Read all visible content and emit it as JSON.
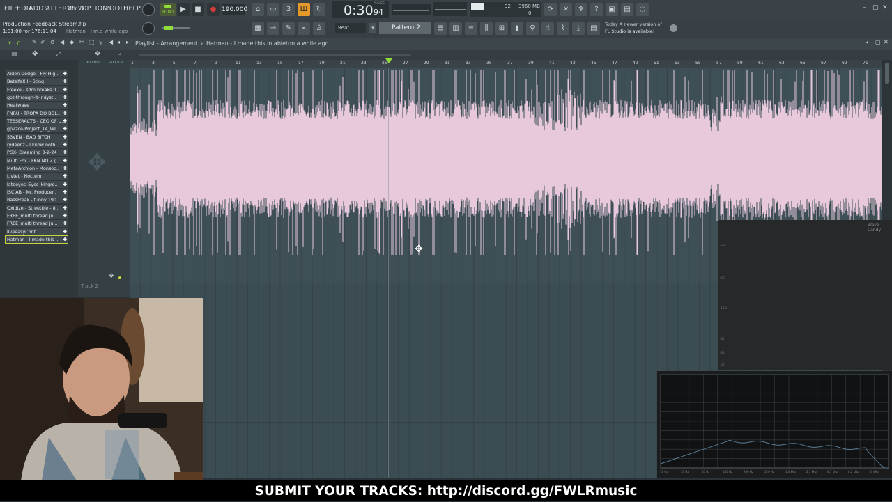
{
  "menu": {
    "items": [
      "FILE",
      "EDIT",
      "ADD",
      "PATTERNS",
      "VIEW",
      "OPTIONS",
      "TOOLS",
      "HELP"
    ]
  },
  "transport": {
    "mode_label": "SONG",
    "tempo": "190.000",
    "time_main": "0:30",
    "time_sub": "94",
    "time_unit": "M:S:CS",
    "cpu_number": "32",
    "memory": "3960 MB",
    "voices": "0"
  },
  "project": {
    "filename": "Production Feedback Stream.flp",
    "timecode": "1:01:00 for 176:11:04",
    "hint": "Hatman - I m.a while ago"
  },
  "toolbar2": {
    "snap_label": "Beat",
    "pattern_label": "Pattern 2"
  },
  "news": {
    "line1": "Today  A newer version of",
    "line2": "FL Studio is available!"
  },
  "playlist": {
    "title": "Playlist - Arrangement",
    "separator": "›",
    "clip_name": "Hatman - I made this in ableton a while ago",
    "xcross_label": "X-CROSS",
    "stretch_label": "STRETCH",
    "track2_label": "Track 2",
    "ruler_ticks": [
      "1",
      "3",
      "5",
      "7",
      "9",
      "11",
      "13",
      "15",
      "17",
      "19",
      "21",
      "23",
      "25",
      "27",
      "29",
      "31",
      "33",
      "35",
      "37",
      "39",
      "41",
      "43",
      "45",
      "47",
      "49",
      "51",
      "53",
      "55",
      "57",
      "59",
      "61",
      "63",
      "65",
      "67",
      "69",
      "71"
    ]
  },
  "browser": {
    "items": [
      "Aiden Dodge - Fly Hig..",
      "BatsifeXII - Sting",
      "Freexe - sdm breaks 0..",
      "got-through-it-indyst..",
      "Heatwave",
      "FNRU - TROPA DO BOL..",
      "TESSERACTS - CEO OF U..",
      "gp2zce-Project_14_WI..",
      "53VEN - BAD BITCH",
      "rydeenz - I know nothi..",
      "PGX- Dreaming 8-2-24",
      "Multi Fox - FKN NOIZ (..",
      "MetaArchion - Monsoo..",
      "Livtet - Noctem",
      "lateeyes_Eyes_kingro..",
      "ISCIAB - Mr. Producer..",
      "BassFreak - funny 190..",
      "Oxidize - Streetlife - 8..",
      "FREE_multi thread jul..",
      "FREE_multi thread jul..",
      "liveeasyCont",
      "Hatman - I made this i.."
    ]
  },
  "wave_candy": {
    "title": "Wave Candy",
    "db_labels": [
      "+0.1",
      "-2.5",
      "-10.1",
      "-24",
      "-28",
      "-37"
    ]
  },
  "spectrum": {
    "freq_labels": [
      "16 Hz",
      "33 Hz",
      "65 Hz",
      "130 Hz",
      "260 Hz",
      "520 Hz",
      "1.0 kHz",
      "2.1 kHz",
      "4.1 kHz",
      "8.2 kHz",
      "16 kHz"
    ]
  },
  "caption": {
    "text": "SUBMIT YOUR TRACKS: http://discord.gg/FWLRmusic"
  },
  "colors": {
    "waveform": "#e8c9dc",
    "track_bg": "#3e4f56",
    "transport_orange": "#e49a2a",
    "record_red": "#d03b3b",
    "song_green": "#8fdc3a"
  },
  "icons": [
    "play-icon",
    "stop-icon",
    "record-icon",
    "metronome-icon",
    "wait-icon",
    "countdown-icon",
    "loop-record-icon",
    "cpu-icon",
    "wrench-icon",
    "mic-icon",
    "help-icon",
    "save-icon",
    "pen-icon",
    "select-icon",
    "zoom-icon",
    "mute-icon",
    "slice-icon",
    "paint-icon",
    "delete-icon"
  ]
}
